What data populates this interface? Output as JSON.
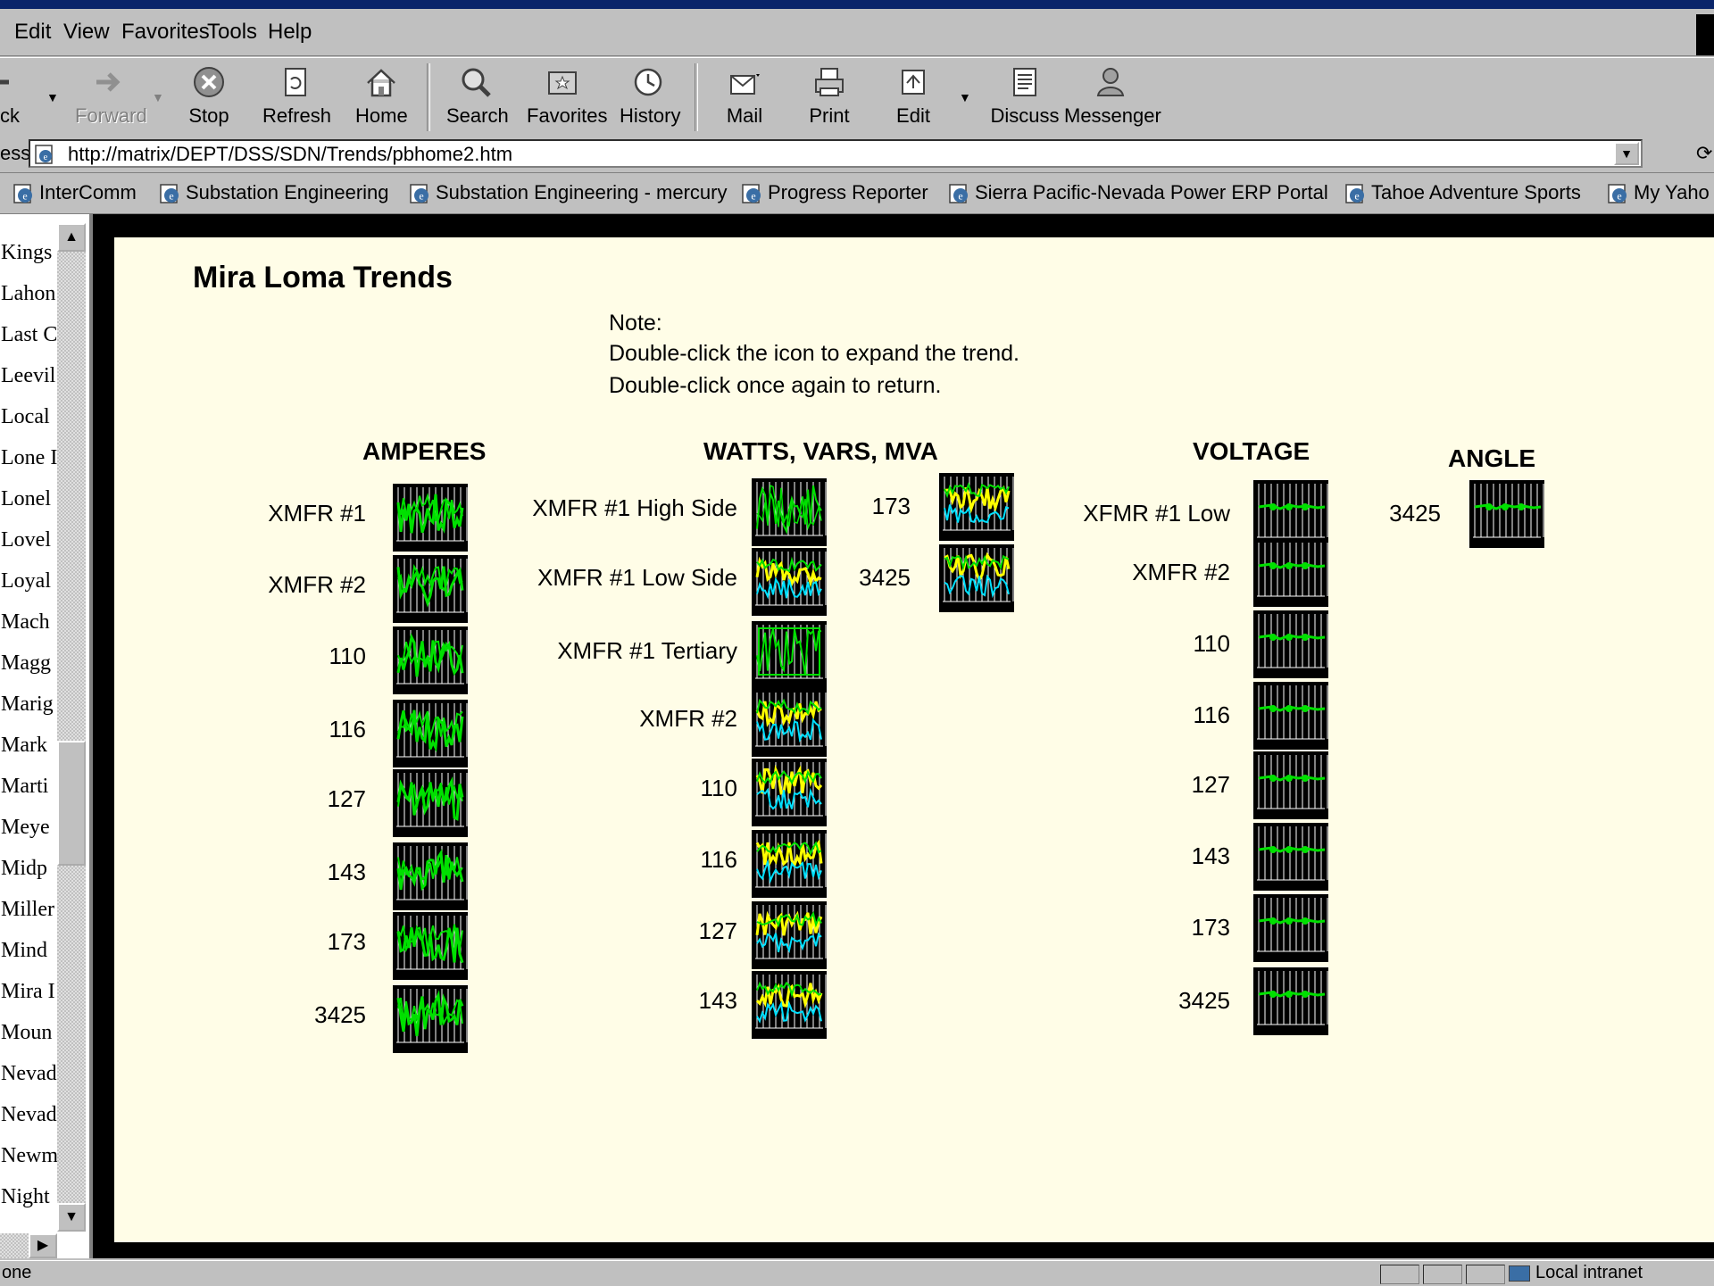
{
  "menu": [
    "Edit",
    "View",
    "Favorites",
    "Tools",
    "Help"
  ],
  "menu_accel": [
    "E",
    "V",
    "a",
    "T",
    "H"
  ],
  "toolbar": {
    "back": "ck",
    "forward": "Forward",
    "stop": "Stop",
    "refresh": "Refresh",
    "home": "Home",
    "search": "Search",
    "favorites": "Favorites",
    "history": "History",
    "mail": "Mail",
    "print": "Print",
    "edit": "Edit",
    "discuss": "Discuss",
    "messenger": "Messenger"
  },
  "address": {
    "label": "ess",
    "url": "http://matrix/DEPT/DSS/SDN/Trends/pbhome2.htm"
  },
  "links": [
    "InterComm",
    "Substation Engineering",
    "Substation Engineering - mercury",
    "Progress Reporter",
    "Sierra Pacific-Nevada Power ERP Portal",
    "Tahoe Adventure Sports",
    "My Yaho"
  ],
  "sidebar": [
    "Kings",
    "Lahon",
    "Last C",
    "Leevil",
    "Local",
    "Lone I",
    "Lonel",
    "Lovel",
    "Loyal",
    "Mach",
    "Magg",
    "Marig",
    "Mark",
    "Marti",
    "Meye",
    "Midp",
    "Miller",
    "Mind",
    "Mira I",
    "Moun",
    "Nevad",
    "Nevad",
    "Newm",
    "Night"
  ],
  "page": {
    "title": "Mira Loma Trends",
    "note": [
      "Note:",
      "Double-click the icon to expand the trend.",
      "Double-click once again to return."
    ]
  },
  "columns": {
    "amperes": {
      "heading": "AMPERES",
      "rows": [
        "XMFR #1",
        "XMFR #2",
        "110",
        "116",
        "127",
        "143",
        "173",
        "3425"
      ]
    },
    "watts": {
      "heading": "WATTS, VARS, MVA",
      "rows": [
        "XMFR #1 High Side",
        "XMFR #1 Low Side",
        "XMFR #1 Tertiary",
        "XMFR #2",
        "110",
        "116",
        "127",
        "143"
      ],
      "extra_rows": [
        "173",
        "3425"
      ]
    },
    "voltage": {
      "heading": "VOLTAGE",
      "rows": [
        "XFMR #1 Low",
        "XMFR #2",
        "110",
        "116",
        "127",
        "143",
        "173",
        "3425"
      ]
    },
    "angle": {
      "heading": "ANGLE",
      "rows": [
        "3425"
      ]
    }
  },
  "status": {
    "text": "one",
    "zone": "Local intranet"
  },
  "colors": {
    "trend_bg": "#000000",
    "trend_green": "#00e000",
    "trend_yellow": "#ffff00",
    "trend_cyan": "#00e0ff",
    "content_bg": "#fffde7"
  }
}
